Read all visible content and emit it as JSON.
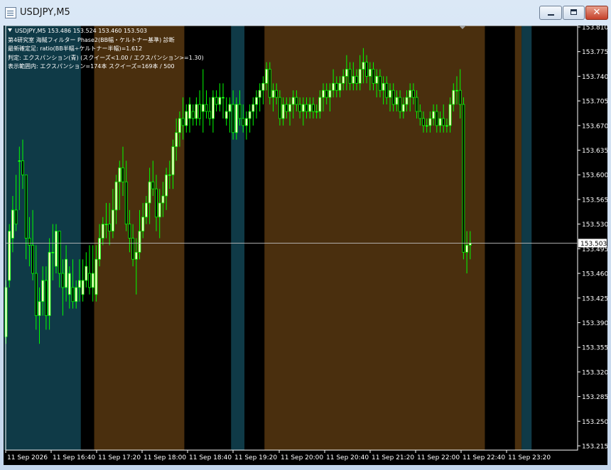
{
  "window": {
    "title": "USDJPY,M5",
    "close_glyph": "✕"
  },
  "info": {
    "line1": "USDJPY,M5  153.486 153.524 153.460 153.503",
    "line2": "第4研究室 海賊フィルター Phase2(BB幅・ケルトナー基準) 診断",
    "line3": "最新確定足: ratio(BB半幅÷ケルトナー半幅)=1.612",
    "line4": "判定: エクスパンション(青) (スクイーズ<1.00 / エクスパンション>=1.30)",
    "line5": "表示範囲内: エクスパンション=174本  スクイーズ=169本  / 500"
  },
  "colors": {
    "bull": "#ffffc8",
    "wick": "#00ff00",
    "expansion": "#0f3a47",
    "squeeze": "#4a2f0e",
    "background": "#000000",
    "crosshair": "#c0c0c0"
  },
  "current_price": "153.503",
  "price_axis": [
    "153.810",
    "153.775",
    "153.740",
    "153.705",
    "153.670",
    "153.635",
    "153.600",
    "153.565",
    "153.530",
    "153.495",
    "153.460",
    "153.425",
    "153.390",
    "153.355",
    "153.320",
    "153.285",
    "153.250",
    "153.215"
  ],
  "time_axis": [
    "11 Sep 2026",
    "11 Sep 16:40",
    "11 Sep 17:20",
    "11 Sep 18:00",
    "11 Sep 18:40",
    "11 Sep 19:20",
    "11 Sep 20:00",
    "11 Sep 20:40",
    "11 Sep 21:20",
    "11 Sep 22:00",
    "11 Sep 22:40",
    "11 Sep 23:20"
  ],
  "chart_data": {
    "type": "candlestick",
    "symbol": "USDJPY",
    "timeframe": "M5",
    "ylim": [
      153.215,
      153.81
    ],
    "bands": [
      {
        "kind": "expansion",
        "from": 0,
        "to": 22
      },
      {
        "kind": "squeeze",
        "from": 27,
        "to": 53
      },
      {
        "kind": "expansion",
        "from": 68,
        "to": 71
      },
      {
        "kind": "squeeze",
        "from": 78,
        "to": 143
      },
      {
        "kind": "squeeze",
        "from": 153,
        "to": 154
      },
      {
        "kind": "expansion",
        "from": 155,
        "to": 157
      }
    ],
    "candles": [
      [
        153.37,
        153.45,
        153.36,
        153.44
      ],
      [
        153.45,
        153.53,
        153.44,
        153.52
      ],
      [
        153.51,
        153.57,
        153.49,
        153.55
      ],
      [
        153.55,
        153.6,
        153.52,
        153.53
      ],
      [
        153.62,
        153.64,
        153.55,
        153.62
      ],
      [
        153.62,
        153.65,
        153.58,
        153.6
      ],
      [
        153.6,
        153.6,
        153.48,
        153.51
      ],
      [
        153.51,
        153.54,
        153.47,
        153.5
      ],
      [
        153.5,
        153.55,
        153.45,
        153.46
      ],
      [
        153.46,
        153.5,
        153.38,
        153.4
      ],
      [
        153.4,
        153.44,
        153.36,
        153.42
      ],
      [
        153.42,
        153.47,
        153.4,
        153.45
      ],
      [
        153.45,
        153.47,
        153.38,
        153.4
      ],
      [
        153.4,
        153.51,
        153.38,
        153.49
      ],
      [
        153.49,
        153.53,
        153.45,
        153.49
      ],
      [
        153.47,
        153.53,
        153.46,
        153.52
      ],
      [
        153.52,
        153.52,
        153.44,
        153.46
      ],
      [
        153.46,
        153.48,
        153.4,
        153.44
      ],
      [
        153.44,
        153.5,
        153.42,
        153.48
      ],
      [
        153.43,
        153.47,
        153.41,
        153.46
      ],
      [
        153.44,
        153.48,
        153.41,
        153.42
      ],
      [
        153.42,
        153.45,
        153.41,
        153.44
      ],
      [
        153.44,
        153.48,
        153.42,
        153.45
      ],
      [
        153.43,
        153.48,
        153.42,
        153.45
      ],
      [
        153.45,
        153.49,
        153.44,
        153.47
      ],
      [
        153.46,
        153.5,
        153.43,
        153.44
      ],
      [
        153.44,
        153.5,
        153.42,
        153.46
      ],
      [
        153.43,
        153.5,
        153.42,
        153.48
      ],
      [
        153.48,
        153.53,
        153.47,
        153.51
      ],
      [
        153.51,
        153.54,
        153.5,
        153.53
      ],
      [
        153.53,
        153.56,
        153.51,
        153.53
      ],
      [
        153.53,
        153.56,
        153.5,
        153.52
      ],
      [
        153.52,
        153.58,
        153.51,
        153.55
      ],
      [
        153.55,
        153.6,
        153.53,
        153.59
      ],
      [
        153.59,
        153.62,
        153.55,
        153.61
      ],
      [
        153.61,
        153.64,
        153.57,
        153.59
      ],
      [
        153.59,
        153.62,
        153.52,
        153.53
      ],
      [
        153.53,
        153.55,
        153.49,
        153.51
      ],
      [
        153.51,
        153.53,
        153.47,
        153.48
      ],
      [
        153.48,
        153.51,
        153.43,
        153.49
      ],
      [
        153.49,
        153.55,
        153.48,
        153.52
      ],
      [
        153.52,
        153.56,
        153.51,
        153.54
      ],
      [
        153.54,
        153.57,
        153.53,
        153.56
      ],
      [
        153.56,
        153.61,
        153.53,
        153.59
      ],
      [
        153.59,
        153.62,
        153.57,
        153.58
      ],
      [
        153.58,
        153.6,
        153.52,
        153.54
      ],
      [
        153.54,
        153.58,
        153.51,
        153.56
      ],
      [
        153.56,
        153.59,
        153.54,
        153.57
      ],
      [
        153.57,
        153.61,
        153.55,
        153.6
      ],
      [
        153.6,
        153.62,
        153.58,
        153.6
      ],
      [
        153.6,
        153.65,
        153.58,
        153.64
      ],
      [
        153.64,
        153.68,
        153.62,
        153.66
      ],
      [
        153.66,
        153.69,
        153.64,
        153.68
      ],
      [
        153.68,
        153.71,
        153.65,
        153.67
      ],
      [
        153.67,
        153.7,
        153.66,
        153.69
      ],
      [
        153.68,
        153.71,
        153.66,
        153.7
      ],
      [
        153.69,
        153.7,
        153.67,
        153.68
      ],
      [
        153.68,
        153.71,
        153.67,
        153.7
      ],
      [
        153.7,
        153.72,
        153.67,
        153.68
      ],
      [
        153.69,
        153.75,
        153.66,
        153.7
      ],
      [
        153.7,
        153.72,
        153.68,
        153.69
      ],
      [
        153.69,
        153.71,
        153.67,
        153.68
      ],
      [
        153.68,
        153.72,
        153.66,
        153.71
      ],
      [
        153.71,
        153.72,
        153.69,
        153.7
      ],
      [
        153.7,
        153.73,
        153.69,
        153.71
      ],
      [
        153.71,
        153.73,
        153.68,
        153.71
      ],
      [
        153.68,
        153.71,
        153.67,
        153.69
      ],
      [
        153.69,
        153.71,
        153.66,
        153.7
      ],
      [
        153.7,
        153.72,
        153.65,
        153.66
      ],
      [
        153.66,
        153.71,
        153.65,
        153.7
      ],
      [
        153.7,
        153.72,
        153.67,
        153.68
      ],
      [
        153.68,
        153.7,
        153.66,
        153.67
      ],
      [
        153.67,
        153.69,
        153.65,
        153.68
      ],
      [
        153.68,
        153.7,
        153.66,
        153.69
      ],
      [
        153.69,
        153.71,
        153.67,
        153.7
      ],
      [
        153.7,
        153.72,
        153.68,
        153.71
      ],
      [
        153.71,
        153.73,
        153.69,
        153.72
      ],
      [
        153.72,
        153.74,
        153.7,
        153.73
      ],
      [
        153.73,
        153.76,
        153.72,
        153.75
      ],
      [
        153.75,
        153.76,
        153.7,
        153.71
      ],
      [
        153.71,
        153.73,
        153.69,
        153.72
      ],
      [
        153.72,
        153.73,
        153.7,
        153.71
      ],
      [
        153.71,
        153.72,
        153.67,
        153.68
      ],
      [
        153.68,
        153.71,
        153.67,
        153.7
      ],
      [
        153.7,
        153.71,
        153.68,
        153.69
      ],
      [
        153.69,
        153.71,
        153.67,
        153.7
      ],
      [
        153.7,
        153.72,
        153.68,
        153.71
      ],
      [
        153.71,
        153.72,
        153.69,
        153.7
      ],
      [
        153.7,
        153.71,
        153.68,
        153.69
      ],
      [
        153.69,
        153.71,
        153.67,
        153.7
      ],
      [
        153.7,
        153.71,
        153.68,
        153.69
      ],
      [
        153.69,
        153.71,
        153.68,
        153.7
      ],
      [
        153.7,
        153.71,
        153.68,
        153.69
      ],
      [
        153.69,
        153.7,
        153.68,
        153.69
      ],
      [
        153.69,
        153.72,
        153.68,
        153.71
      ],
      [
        153.71,
        153.73,
        153.69,
        153.72
      ],
      [
        153.72,
        153.73,
        153.7,
        153.71
      ],
      [
        153.71,
        153.73,
        153.69,
        153.72
      ],
      [
        153.72,
        153.75,
        153.71,
        153.73
      ],
      [
        153.73,
        153.74,
        153.71,
        153.72
      ],
      [
        153.72,
        153.74,
        153.71,
        153.73
      ],
      [
        153.73,
        153.75,
        153.72,
        153.74
      ],
      [
        153.74,
        153.77,
        153.72,
        153.75
      ],
      [
        153.75,
        153.76,
        153.72,
        153.73
      ],
      [
        153.73,
        153.76,
        153.72,
        153.74
      ],
      [
        153.74,
        153.75,
        153.72,
        153.73
      ],
      [
        153.73,
        153.77,
        153.72,
        153.75
      ],
      [
        153.75,
        153.78,
        153.73,
        153.76
      ],
      [
        153.76,
        153.77,
        153.73,
        153.74
      ],
      [
        153.74,
        153.76,
        153.72,
        153.75
      ],
      [
        153.75,
        153.76,
        153.72,
        153.73
      ],
      [
        153.73,
        153.75,
        153.71,
        153.74
      ],
      [
        153.74,
        153.75,
        153.71,
        153.72
      ],
      [
        153.72,
        153.74,
        153.7,
        153.73
      ],
      [
        153.73,
        153.74,
        153.7,
        153.71
      ],
      [
        153.71,
        153.73,
        153.69,
        153.72
      ],
      [
        153.72,
        153.73,
        153.69,
        153.7
      ],
      [
        153.7,
        153.72,
        153.69,
        153.71
      ],
      [
        153.71,
        153.72,
        153.68,
        153.69
      ],
      [
        153.69,
        153.71,
        153.68,
        153.7
      ],
      [
        153.7,
        153.72,
        153.69,
        153.71
      ],
      [
        153.71,
        153.73,
        153.69,
        153.72
      ],
      [
        153.72,
        153.73,
        153.7,
        153.71
      ],
      [
        153.71,
        153.72,
        153.68,
        153.69
      ],
      [
        153.69,
        153.7,
        153.67,
        153.68
      ],
      [
        153.68,
        153.69,
        153.66,
        153.67
      ],
      [
        153.67,
        153.68,
        153.66,
        153.67
      ],
      [
        153.67,
        153.69,
        153.66,
        153.68
      ],
      [
        153.68,
        153.7,
        153.67,
        153.69
      ],
      [
        153.69,
        153.7,
        153.66,
        153.67
      ],
      [
        153.67,
        153.69,
        153.66,
        153.68
      ],
      [
        153.68,
        153.7,
        153.66,
        153.67
      ],
      [
        153.67,
        153.68,
        153.66,
        153.67
      ],
      [
        153.67,
        153.71,
        153.66,
        153.7
      ],
      [
        153.7,
        153.73,
        153.69,
        153.72
      ],
      [
        153.72,
        153.74,
        153.7,
        153.72
      ],
      [
        153.72,
        153.75,
        153.68,
        153.7
      ],
      [
        153.7,
        153.71,
        153.48,
        153.49
      ],
      [
        153.49,
        153.52,
        153.46,
        153.5
      ],
      [
        153.5,
        153.52,
        153.48,
        153.503
      ]
    ]
  }
}
